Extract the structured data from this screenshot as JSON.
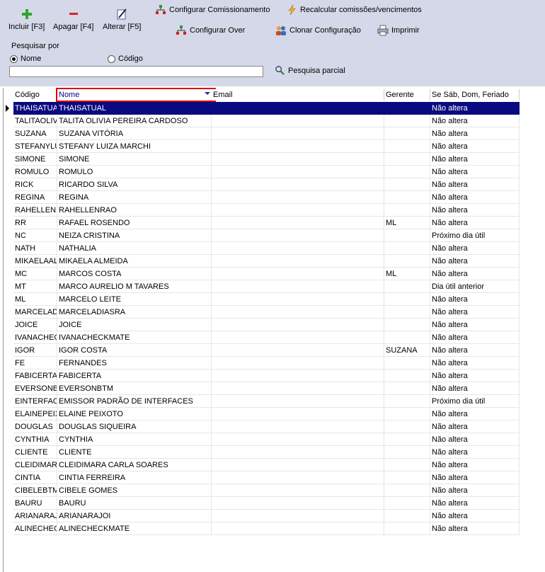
{
  "toolbar": {
    "incluir": "Incluir [F3]",
    "apagar": "Apagar [F4]",
    "alterar": "Alterar [F5]",
    "configurar_comissionamento": "Configurar Comissionamento",
    "recalcular": "Recalcular comissões/vencimentos",
    "configurar_over": "Configurar Over",
    "clonar": "Clonar Configuração",
    "imprimir": "Imprimir"
  },
  "search": {
    "group_label": "Pesquisar por",
    "option_nome": "Nome",
    "option_codigo": "Código",
    "selected": "Nome",
    "value": "",
    "partial_label": "Pesquisa parcial"
  },
  "columns": [
    "Código",
    "Nome",
    "Email",
    "Gerente",
    "Se Sáb, Dom, Feriado"
  ],
  "rows": [
    [
      "THAISATUAL",
      "THAISATUAL",
      "",
      "",
      "Não altera"
    ],
    [
      "TALITAOLIV",
      "TALITA OLIVIA PEREIRA CARDOSO",
      "",
      "",
      "Não altera"
    ],
    [
      "SUZANA",
      "SUZANA VITÓRIA",
      "",
      "",
      "Não altera"
    ],
    [
      "STEFANYLU",
      "STEFANY LUIZA MARCHI",
      "",
      "",
      "Não altera"
    ],
    [
      "SIMONE",
      "SIMONE",
      "",
      "",
      "Não altera"
    ],
    [
      "ROMULO",
      "ROMULO",
      "",
      "",
      "Não altera"
    ],
    [
      "RICK",
      "RICARDO SILVA",
      "",
      "",
      "Não altera"
    ],
    [
      "REGINA",
      "REGINA",
      "",
      "",
      "Não altera"
    ],
    [
      "RAHELLENF",
      "RAHELLENRAO",
      "",
      "",
      "Não altera"
    ],
    [
      "RR",
      "RAFAEL ROSENDO",
      "",
      "ML",
      "Não altera"
    ],
    [
      "NC",
      "NEIZA CRISTINA",
      "",
      "",
      "Próximo dia útil"
    ],
    [
      "NATH",
      "NATHALIA",
      "",
      "",
      "Não altera"
    ],
    [
      "MIKAELAALI",
      "MIKAELA ALMEIDA",
      "",
      "",
      "Não altera"
    ],
    [
      "MC",
      "MARCOS COSTA",
      "",
      "ML",
      "Não altera"
    ],
    [
      "MT",
      "MARCO AURELIO M TAVARES",
      "",
      "",
      "Dia útil anterior"
    ],
    [
      "ML",
      "MARCELO LEITE",
      "",
      "",
      "Não altera"
    ],
    [
      "MARCELADI",
      "MARCELADIASRA",
      "",
      "",
      "Não altera"
    ],
    [
      "JOICE",
      "JOICE",
      "",
      "",
      "Não altera"
    ],
    [
      "IVANACHEC",
      "IVANACHECKMATE",
      "",
      "",
      "Não altera"
    ],
    [
      "IGOR",
      "IGOR COSTA",
      "",
      "SUZANA",
      "Não altera"
    ],
    [
      "FE",
      "FERNANDES",
      "",
      "",
      "Não altera"
    ],
    [
      "FABICERTA",
      "FABICERTA",
      "",
      "",
      "Não altera"
    ],
    [
      "EVERSONBT",
      "EVERSONBTM",
      "",
      "",
      "Não altera"
    ],
    [
      "EINTERFACI",
      "EMISSOR PADRÃO DE INTERFACES",
      "",
      "",
      "Próximo dia útil"
    ],
    [
      "ELAINEPEIX",
      "ELAINE PEIXOTO",
      "",
      "",
      "Não altera"
    ],
    [
      "DOUGLAS",
      "DOUGLAS SIQUEIRA",
      "",
      "",
      "Não altera"
    ],
    [
      "CYNTHIA",
      "CYNTHIA",
      "",
      "",
      "Não altera"
    ],
    [
      "CLIENTE",
      "CLIENTE",
      "",
      "",
      "Não altera"
    ],
    [
      "CLEIDIMARA",
      "CLEIDIMARA CARLA SOARES",
      "",
      "",
      "Não altera"
    ],
    [
      "CINTIA",
      "CINTIA FERREIRA",
      "",
      "",
      "Não altera"
    ],
    [
      "CIBELEBTM",
      "CIBELE GOMES",
      "",
      "",
      "Não altera"
    ],
    [
      "BAURU",
      "BAURU",
      "",
      "",
      "Não altera"
    ],
    [
      "ARIANARAJI",
      "ARIANARAJOI",
      "",
      "",
      "Não altera"
    ],
    [
      "ALINECHECI",
      "ALINECHECKMATE",
      "",
      "",
      "Não altera"
    ]
  ],
  "selected_row": 0
}
